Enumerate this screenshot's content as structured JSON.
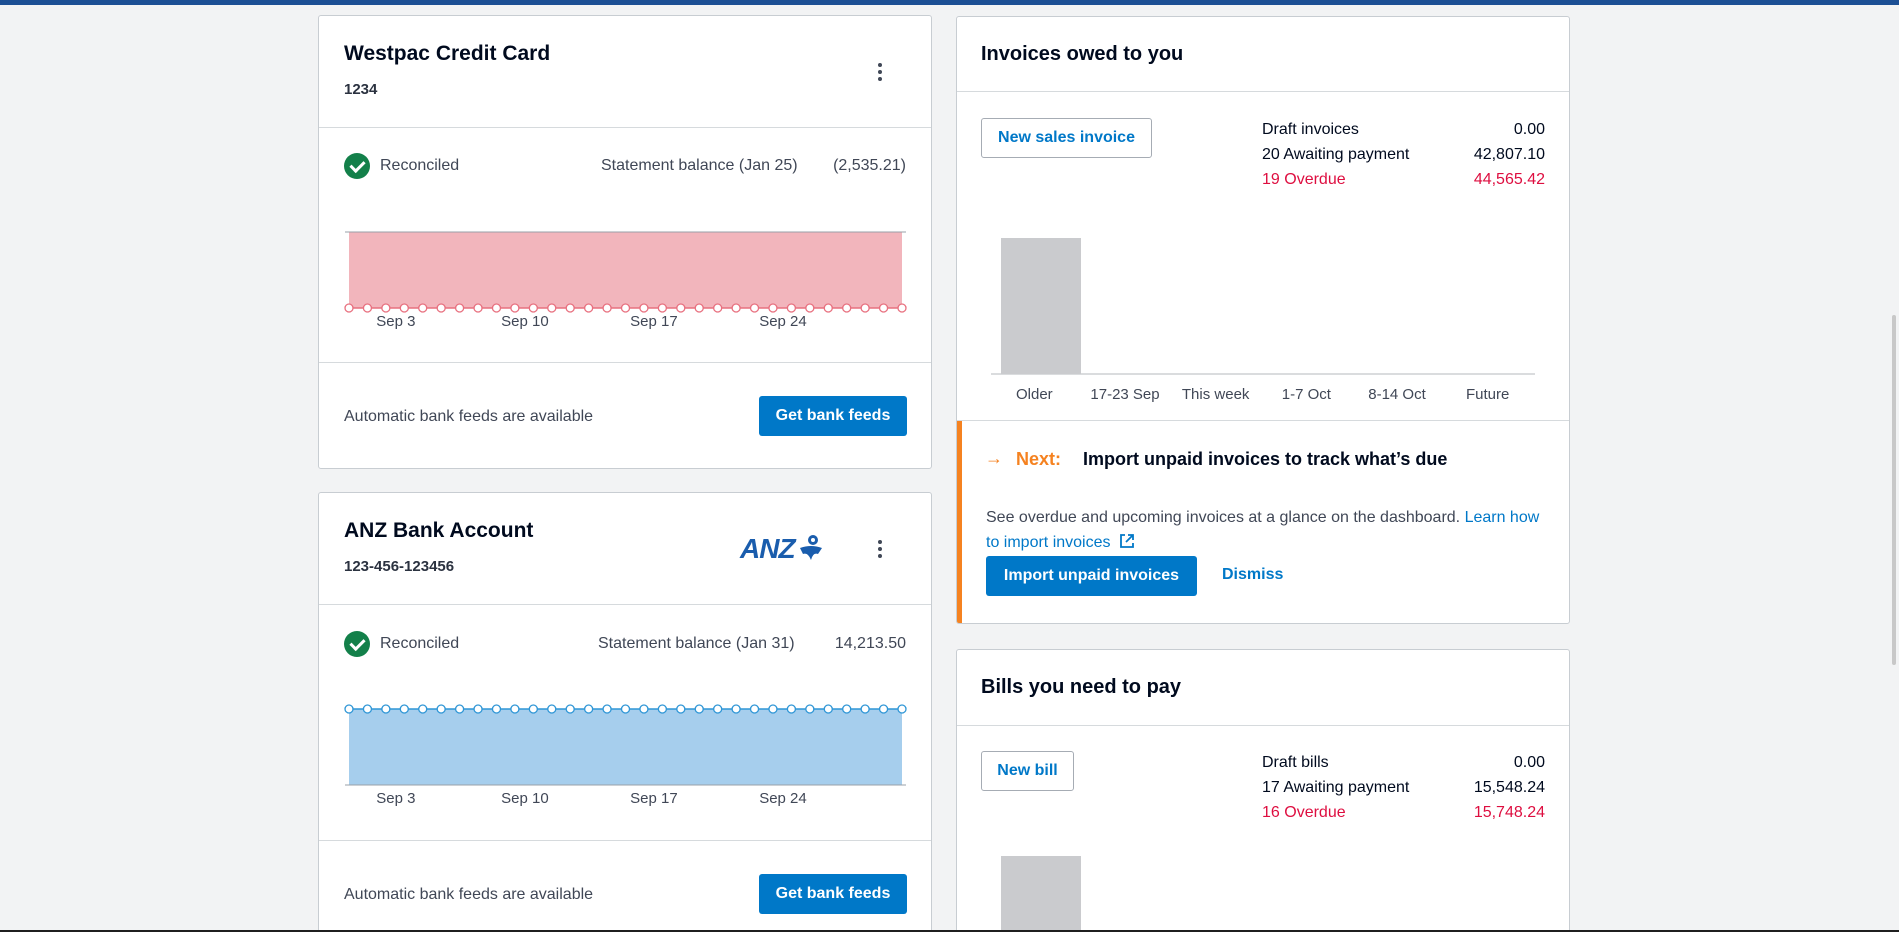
{
  "accounts": [
    {
      "name": "Westpac Credit Card",
      "number": "1234",
      "status": "Reconciled",
      "statement_label": "Statement balance (Jan 25)",
      "statement_value": "(2,535.21)",
      "feeds_text": "Automatic bank feeds are available",
      "feeds_button": "Get bank feeds",
      "chart": {
        "type": "area",
        "color": "#f2b5bc",
        "line_color": "#e8707f",
        "balance_sign": "negative",
        "x_ticks": [
          "Sep 3",
          "Sep 10",
          "Sep 17",
          "Sep 24"
        ],
        "points": 31
      }
    },
    {
      "name": "ANZ Bank Account",
      "number": "123-456-123456",
      "logo_text": "ANZ",
      "status": "Reconciled",
      "statement_label": "Statement balance (Jan 31)",
      "statement_value": "14,213.50",
      "feeds_text": "Automatic bank feeds are available",
      "feeds_button": "Get bank feeds",
      "chart": {
        "type": "area",
        "color": "#a6ceed",
        "line_color": "#2f96d6",
        "balance_sign": "positive",
        "x_ticks": [
          "Sep 3",
          "Sep 10",
          "Sep 17",
          "Sep 24"
        ],
        "points": 31
      }
    }
  ],
  "invoices": {
    "title": "Invoices owed to you",
    "new_button": "New sales invoice",
    "summary": [
      {
        "label": "Draft invoices",
        "value": "0.00",
        "overdue": false
      },
      {
        "label": "20 Awaiting payment",
        "value": "42,807.10",
        "overdue": false
      },
      {
        "label": "19 Overdue",
        "value": "44,565.42",
        "overdue": true
      }
    ],
    "chart_data": {
      "type": "bar",
      "categories": [
        "Older",
        "17-23 Sep",
        "This week",
        "1-7 Oct",
        "8-14 Oct",
        "Future"
      ],
      "values": [
        1,
        0,
        0,
        0,
        0,
        0
      ],
      "bar_color": "#cacbce"
    },
    "next": {
      "label": "Next:",
      "title": "Import unpaid invoices to track what’s due",
      "body": "See overdue and upcoming invoices at a glance on the dashboard.",
      "link": "Learn how to import invoices",
      "primary_button": "Import unpaid invoices",
      "dismiss_button": "Dismiss"
    }
  },
  "bills": {
    "title": "Bills you need to pay",
    "new_button": "New bill",
    "summary": [
      {
        "label": "Draft bills",
        "value": "0.00",
        "overdue": false
      },
      {
        "label": "17 Awaiting payment",
        "value": "15,548.24",
        "overdue": false
      },
      {
        "label": "16 Overdue",
        "value": "15,748.24",
        "overdue": true
      }
    ]
  },
  "colors": {
    "accent": "#0078c8",
    "overdue": "#de0e40",
    "reconciled": "#13804a",
    "next": "#f58220"
  }
}
